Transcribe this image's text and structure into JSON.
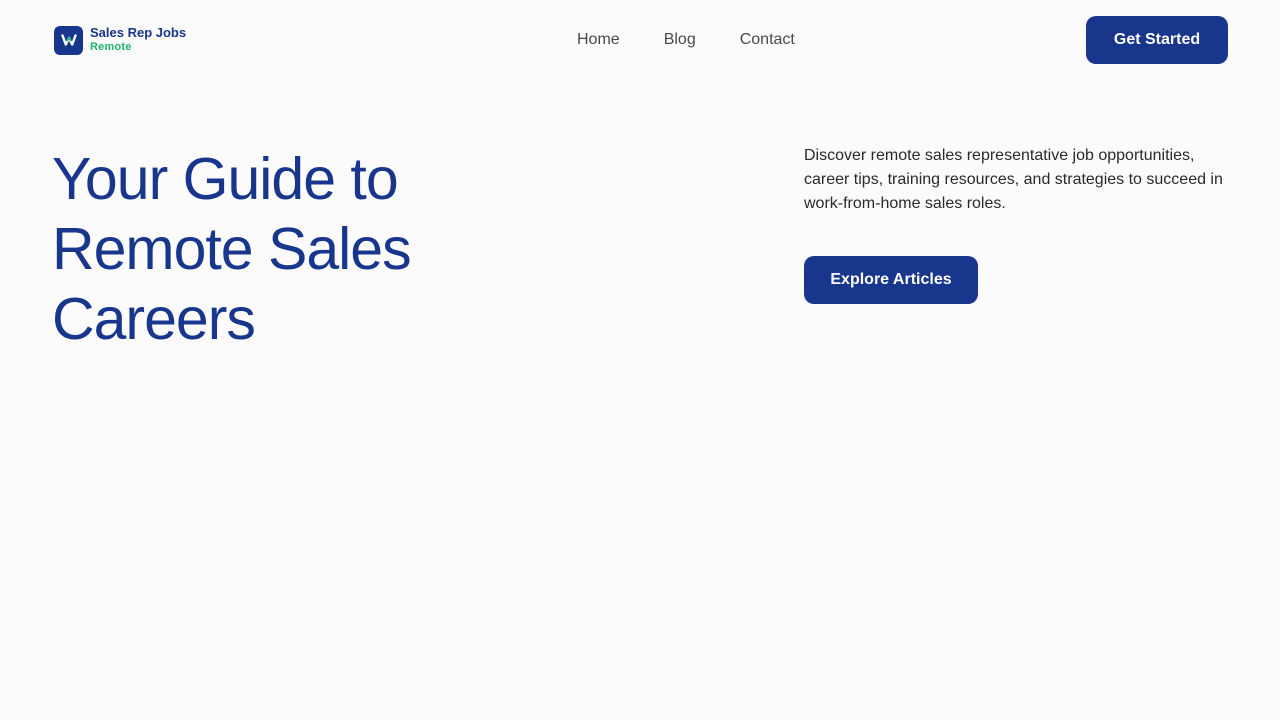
{
  "brand": {
    "logo_icon": "w-logo-icon",
    "title": "Sales Rep Jobs",
    "subtitle": "Remote",
    "primary_color": "#17368c",
    "accent_color": "#1fb36e"
  },
  "nav": {
    "items": [
      {
        "label": "Home"
      },
      {
        "label": "Blog"
      },
      {
        "label": "Contact"
      }
    ]
  },
  "header": {
    "cta_label": "Get Started"
  },
  "hero": {
    "title": "Your Guide to Remote Sales Careers",
    "description": "Discover remote sales representative job opportunities, career tips, training resources, and strategies to succeed in work-from-home sales roles.",
    "cta_label": "Explore Articles"
  }
}
